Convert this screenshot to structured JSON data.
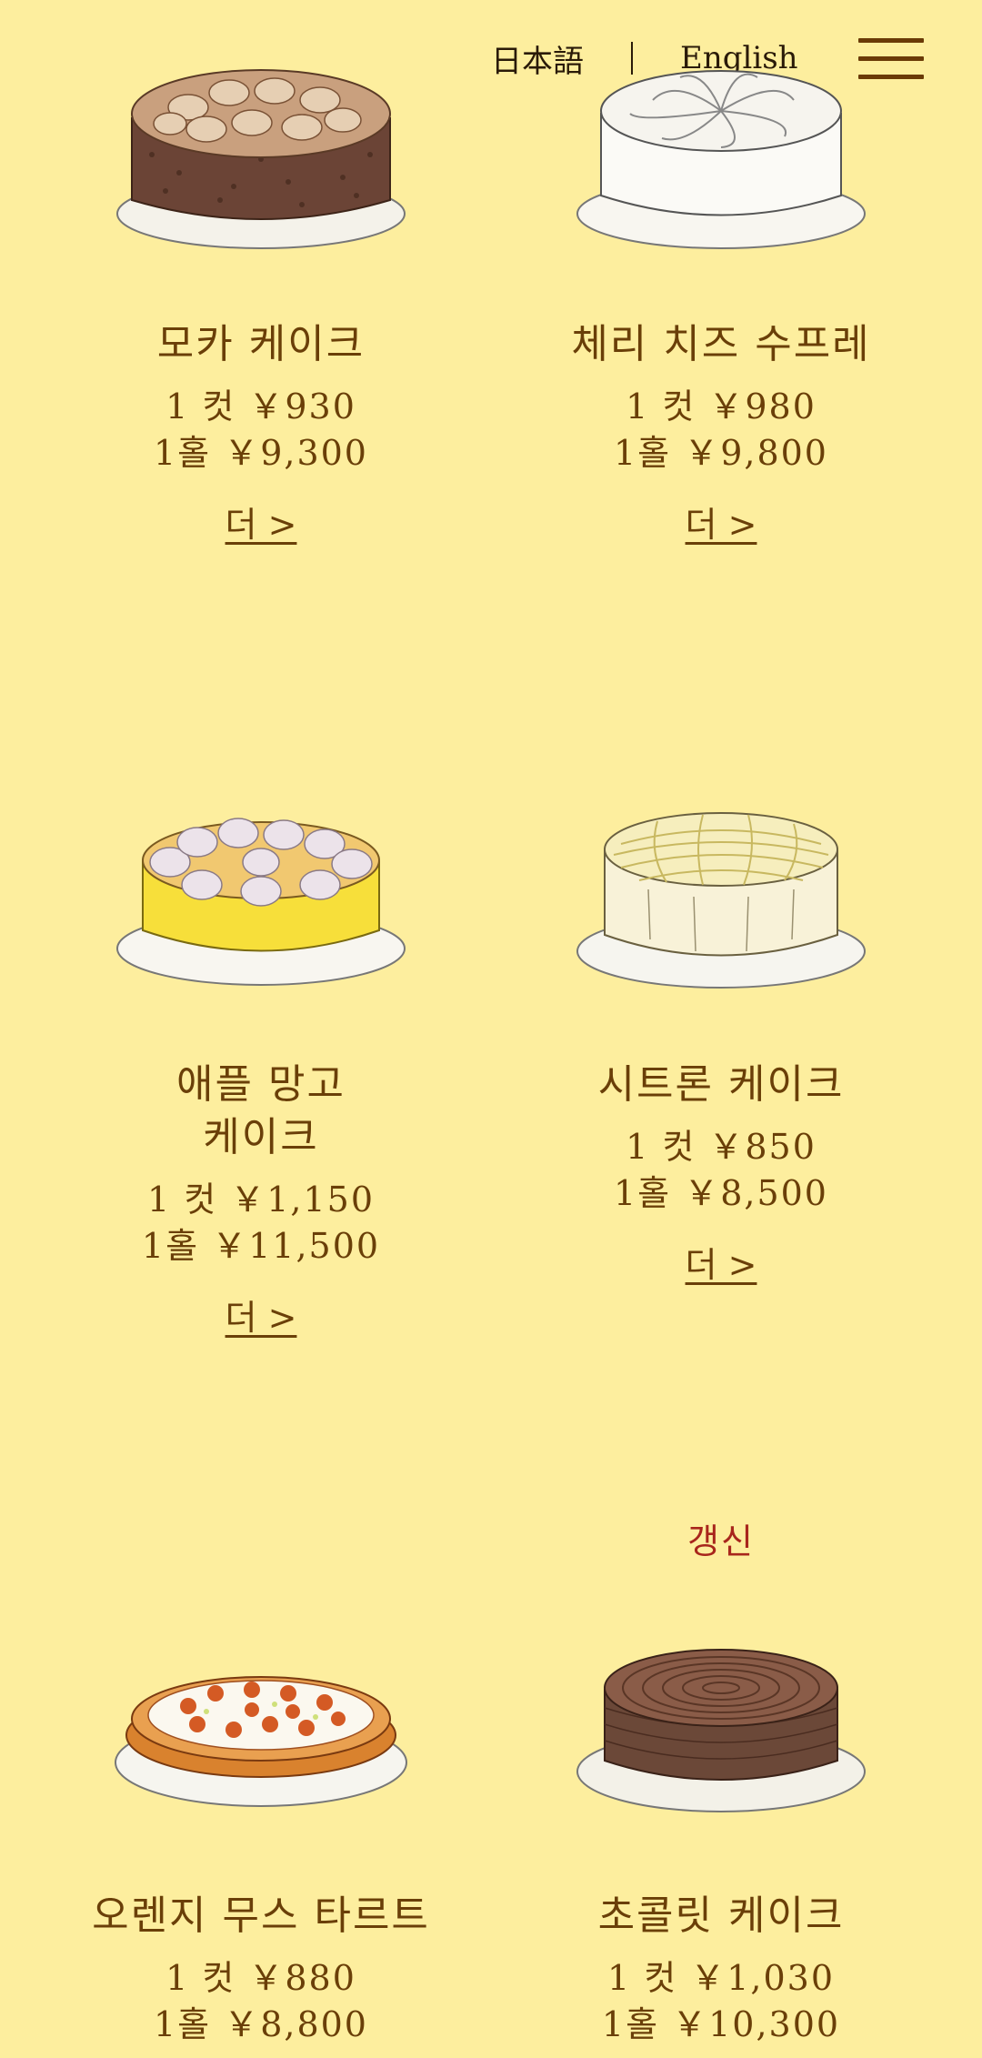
{
  "header": {
    "lang_japanese": "日本語",
    "lang_english": "English",
    "menu_icon": "hamburger-icon"
  },
  "colors": {
    "background": "#fdee9e",
    "text": "#6a3f08",
    "badge": "#a8261c"
  },
  "products": [
    {
      "name": "모카 케이크",
      "price_cut": "1 컷 ￥930",
      "price_whole": "1홀 ￥9,300",
      "more": "더 >",
      "image": "mocha-cake-illustration"
    },
    {
      "name": "체리 치즈 수프레",
      "price_cut": "1 컷 ￥980",
      "price_whole": "1홀 ￥9,800",
      "more": "더 >",
      "image": "cherry-cheese-souffle-illustration"
    },
    {
      "name_line1": "애플 망고",
      "name_line2": "케이크",
      "price_cut": "1 컷 ￥1,150",
      "price_whole": "1홀 ￥11,500",
      "more": "더 >",
      "image": "apple-mango-cake-illustration"
    },
    {
      "name": "시트론 케이크",
      "price_cut": "1 컷 ￥850",
      "price_whole": "1홀 ￥8,500",
      "more": "더 >",
      "image": "citron-cake-illustration"
    },
    {
      "name": "오렌지 무스 타르트",
      "price_cut": "1 컷 ￥880",
      "price_whole": "1홀 ￥8,800",
      "image": "orange-mousse-tart-illustration"
    },
    {
      "badge": "갱신",
      "name": "초콜릿 케이크",
      "price_cut": "1 컷 ￥1,030",
      "price_whole": "1홀 ￥10,300",
      "image": "chocolate-cake-illustration"
    }
  ]
}
